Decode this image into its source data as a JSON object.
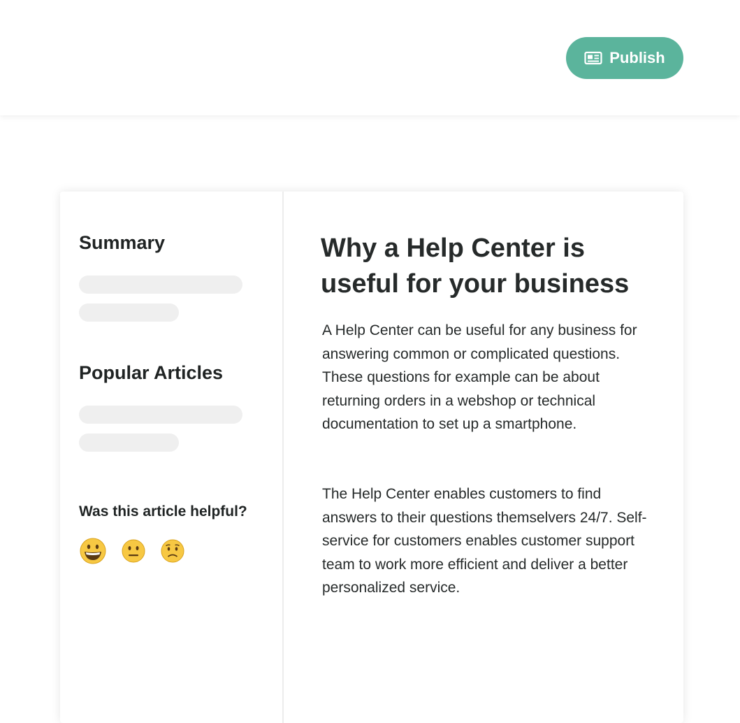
{
  "header": {
    "publish_label": "Publish",
    "publish_icon": "newspaper-icon",
    "button_color": "#5bb49c"
  },
  "sidebar": {
    "summary_heading": "Summary",
    "popular_heading": "Popular Articles",
    "feedback_question": "Was this article helpful?",
    "feedback_options": [
      "grinning-face-icon",
      "neutral-face-icon",
      "worried-face-icon"
    ]
  },
  "article": {
    "title": "Why a Help Center is useful for your business",
    "paragraphs": [
      "A Help Center can be useful for any business for answering common or complicated questions. These questions for example can be about returning orders in a webshop or technical documentation to set up a smartphone.",
      "The Help Center enables customers to find answers to their questions themselvers 24/7. Self-service for customers enables customer support team to work more efficient and deliver a better personalized service."
    ]
  }
}
